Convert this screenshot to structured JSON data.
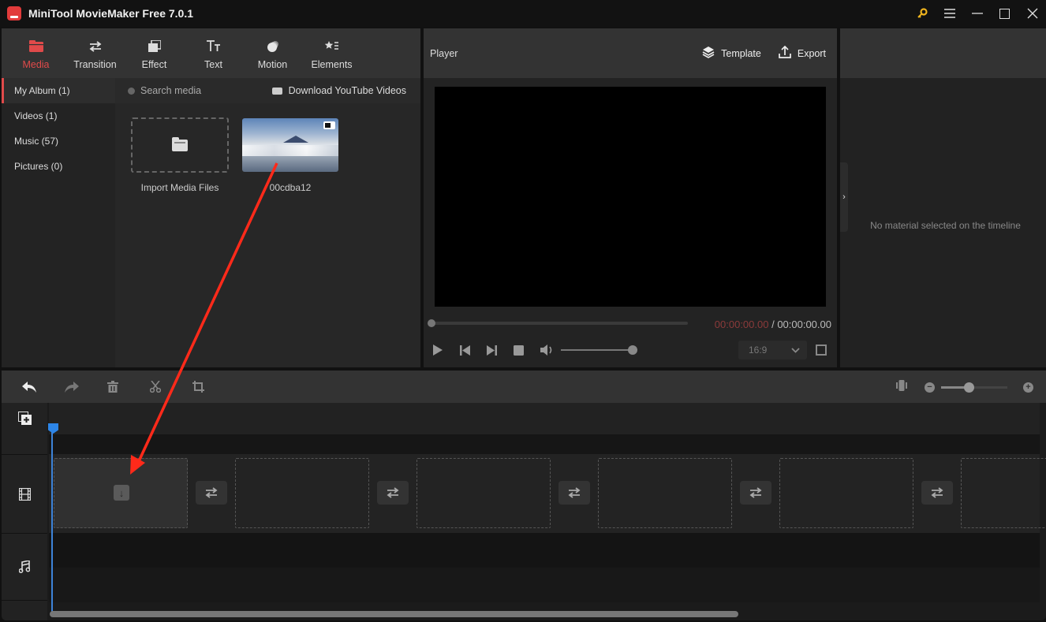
{
  "window": {
    "title": "MiniTool MovieMaker Free 7.0.1",
    "controls": [
      "key-icon",
      "menu-icon",
      "minimize-icon",
      "maximize-icon",
      "close-icon"
    ]
  },
  "tabs": [
    {
      "label": "Media",
      "icon": "folder-icon",
      "active": true
    },
    {
      "label": "Transition",
      "icon": "swap-icon",
      "active": false
    },
    {
      "label": "Effect",
      "icon": "layers-icon",
      "active": false
    },
    {
      "label": "Text",
      "icon": "text-icon",
      "active": false
    },
    {
      "label": "Motion",
      "icon": "motion-icon",
      "active": false
    },
    {
      "label": "Elements",
      "icon": "star-list-icon",
      "active": false
    }
  ],
  "sidebar": {
    "items": [
      {
        "label": "My Album (1)",
        "active": true
      },
      {
        "label": "Videos (1)",
        "active": false
      },
      {
        "label": "Music (57)",
        "active": false
      },
      {
        "label": "Pictures (0)",
        "active": false
      }
    ]
  },
  "media": {
    "search_placeholder": "Search media",
    "download_label": "Download YouTube Videos",
    "import_label": "Import Media Files",
    "clip_name": "00cdba12"
  },
  "player": {
    "title": "Player",
    "template_label": "Template",
    "export_label": "Export",
    "current_time": "00:00:00.00",
    "separator": " / ",
    "total_time": "00:00:00.00",
    "aspect_ratio": "16:9",
    "volume_fraction": 1.0,
    "progress_fraction": 0.0
  },
  "properties": {
    "empty_message": "No material selected on the timeline"
  },
  "timeline": {
    "tools": [
      "undo",
      "redo",
      "delete",
      "split",
      "crop"
    ],
    "zoom_fraction": 0.42,
    "video_slots": 6,
    "accent_color": "#2d86e8"
  },
  "annotation": {
    "arrow_color": "#ff2a1a"
  }
}
